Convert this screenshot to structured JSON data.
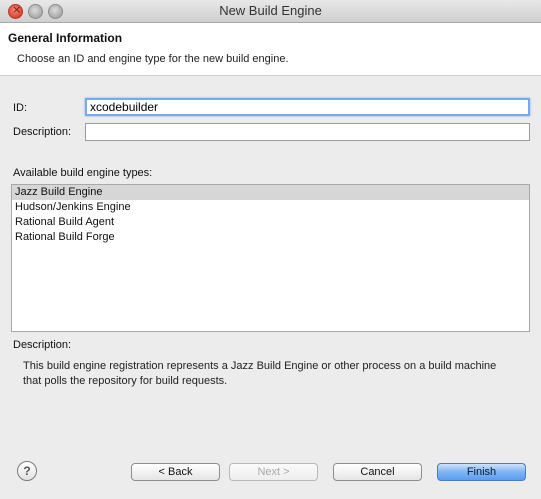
{
  "window": {
    "title": "New Build Engine"
  },
  "header": {
    "title": "General Information",
    "description": "Choose an ID and engine type for the new build engine."
  },
  "form": {
    "id_label": "ID:",
    "id_value": "xcodebuilder",
    "description_label": "Description:",
    "description_value": ""
  },
  "engine_types": {
    "label": "Available build engine types:",
    "items": [
      {
        "label": "Jazz Build Engine",
        "selected": true
      },
      {
        "label": "Hudson/Jenkins Engine",
        "selected": false
      },
      {
        "label": "Rational Build Agent",
        "selected": false
      },
      {
        "label": "Rational Build Forge",
        "selected": false
      }
    ]
  },
  "description_section": {
    "label": "Description:",
    "text": "This build engine registration represents a Jazz Build Engine or other process on a build machine that polls the repository for build requests."
  },
  "buttons": {
    "help": "?",
    "back": "< Back",
    "next": "Next >",
    "cancel": "Cancel",
    "finish": "Finish"
  },
  "colors": {
    "selection": "#d6d6d6",
    "focus_ring": "#7aa9e8",
    "default_button": "#5d9df0"
  }
}
